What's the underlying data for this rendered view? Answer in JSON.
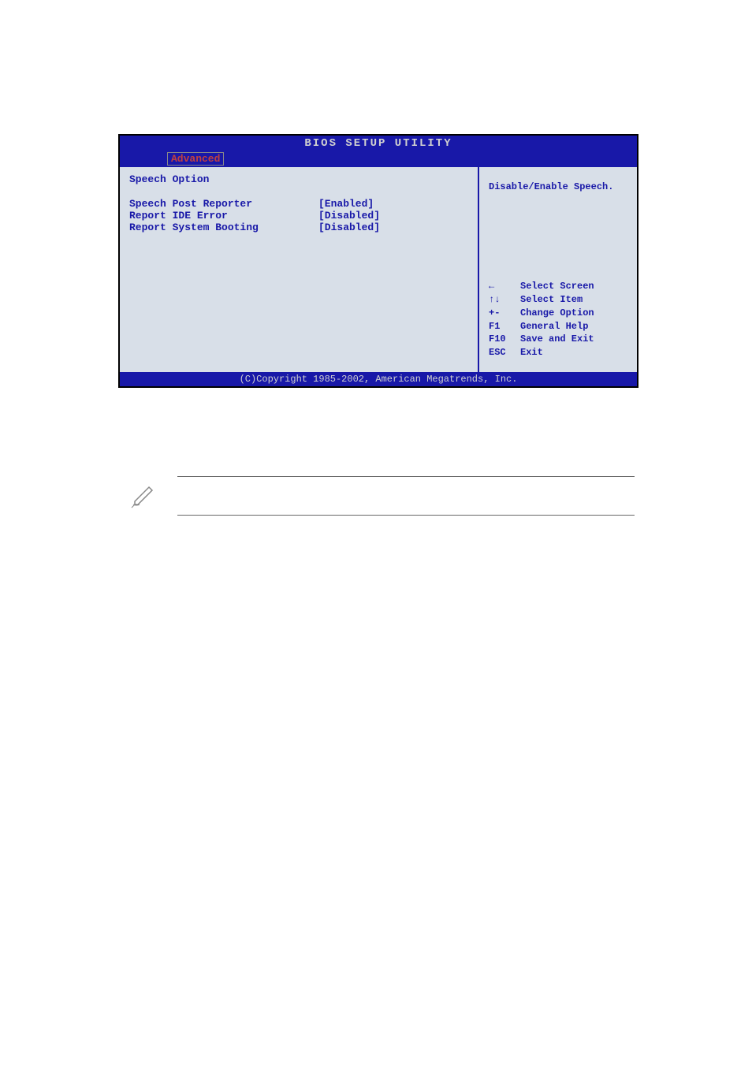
{
  "bios": {
    "title": "BIOS SETUP UTILITY",
    "tab": "Advanced",
    "section_title": "Speech Option",
    "options": [
      {
        "label": "Speech Post Reporter",
        "value": "[Enabled]"
      },
      {
        "label": "Report IDE Error",
        "value": "[Disabled]"
      },
      {
        "label": "Report System Booting",
        "value": "[Disabled]"
      }
    ],
    "help_text": "Disable/Enable Speech.",
    "nav": [
      {
        "key": "←",
        "desc": "Select Screen"
      },
      {
        "key": "↑↓",
        "desc": "Select Item"
      },
      {
        "key": "+-",
        "desc": "Change Option"
      },
      {
        "key": "F1",
        "desc": "General Help"
      },
      {
        "key": "F10",
        "desc": "Save and Exit"
      },
      {
        "key": "ESC",
        "desc": "Exit"
      }
    ],
    "footer": "(C)Copyright 1985-2002, American Megatrends, Inc."
  }
}
